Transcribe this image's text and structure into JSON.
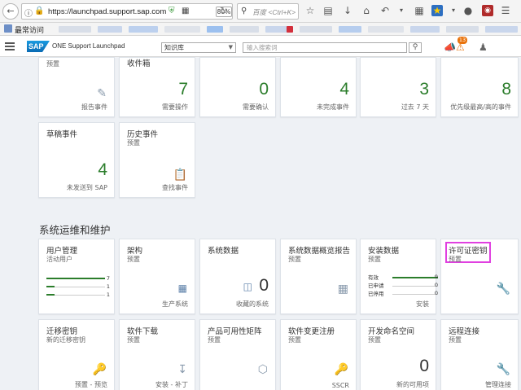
{
  "browser": {
    "url": "https://launchpad.support.sap.com",
    "zoom": "80%",
    "search_placeholder": "百度 <Ctrl+K>",
    "bookmarks_label": "最常访问"
  },
  "header": {
    "logo": "SAP",
    "app_title": "ONE Support Launchpad",
    "select_value": "知识库",
    "search_placeholder": "输入搜索词",
    "notification_count": "13"
  },
  "top_tiles": [
    {
      "title": "",
      "subtitle": "预置",
      "number": "",
      "footer": "报告事件"
    },
    {
      "title": "收件箱",
      "subtitle": "",
      "number": "7",
      "footer": "需要操作"
    },
    {
      "title": "",
      "subtitle": "",
      "number": "0",
      "footer": "需要确认"
    },
    {
      "title": "",
      "subtitle": "",
      "number": "4",
      "footer": "未完成事件"
    },
    {
      "title": "",
      "subtitle": "",
      "number": "3",
      "footer": "过去 7 天"
    },
    {
      "title": "",
      "subtitle": "",
      "number": "8",
      "footer": "优先级最高/高的事件"
    }
  ],
  "second_tiles": [
    {
      "title": "草稿事件",
      "subtitle": "",
      "number": "4",
      "footer": "未发送到 SAP"
    },
    {
      "title": "历史事件",
      "subtitle": "预置",
      "number": "",
      "footer": "查找事件"
    }
  ],
  "section_title": "系统运维和维护",
  "ops_tiles": [
    {
      "title": "用户管理",
      "subtitle": "活动用户",
      "number": "",
      "footer": ""
    },
    {
      "title": "架构",
      "subtitle": "预置",
      "number": "",
      "footer": "生产系统"
    },
    {
      "title": "系统数据",
      "subtitle": "",
      "number": "0",
      "footer": "收藏的系统"
    },
    {
      "title": "系统数据概览报告",
      "subtitle": "预置",
      "number": "",
      "footer": ""
    },
    {
      "title": "安装数据",
      "subtitle": "预置",
      "number": "",
      "footer": "安装"
    },
    {
      "title": "许可证密钥",
      "subtitle": "预置",
      "number": "",
      "footer": ""
    }
  ],
  "user_bars": [
    {
      "value": "7",
      "fraction": 1.0
    },
    {
      "value": "1",
      "fraction": 0.14
    },
    {
      "value": "1",
      "fraction": 0.14
    }
  ],
  "install_bars": [
    {
      "label": "有效",
      "value": "9",
      "fraction": 1.0
    },
    {
      "label": "已申请",
      "value": "0",
      "fraction": 0
    },
    {
      "label": "已停用",
      "value": "0",
      "fraction": 0
    }
  ],
  "bottom_tiles": [
    {
      "title": "迁移密钥",
      "subtitle": "新的迁移密钥",
      "number": "",
      "footer": "预置 - 预览"
    },
    {
      "title": "软件下载",
      "subtitle": "预置",
      "number": "",
      "footer": "安装 - 补丁"
    },
    {
      "title": "产品可用性矩阵",
      "subtitle": "预置",
      "number": "",
      "footer": ""
    },
    {
      "title": "软件变更注册",
      "subtitle": "预置",
      "number": "",
      "footer": "SSCR"
    },
    {
      "title": "开发命名空间",
      "subtitle": "预置",
      "number": "0",
      "footer": "新的可用项"
    },
    {
      "title": "远程连接",
      "subtitle": "预置",
      "number": "",
      "footer": "管理连接"
    }
  ],
  "colors": {
    "accent": "#2b7d2b",
    "sap_blue": "#0a6ab3",
    "highlight": "#e040e0",
    "badge": "#e9730c"
  }
}
